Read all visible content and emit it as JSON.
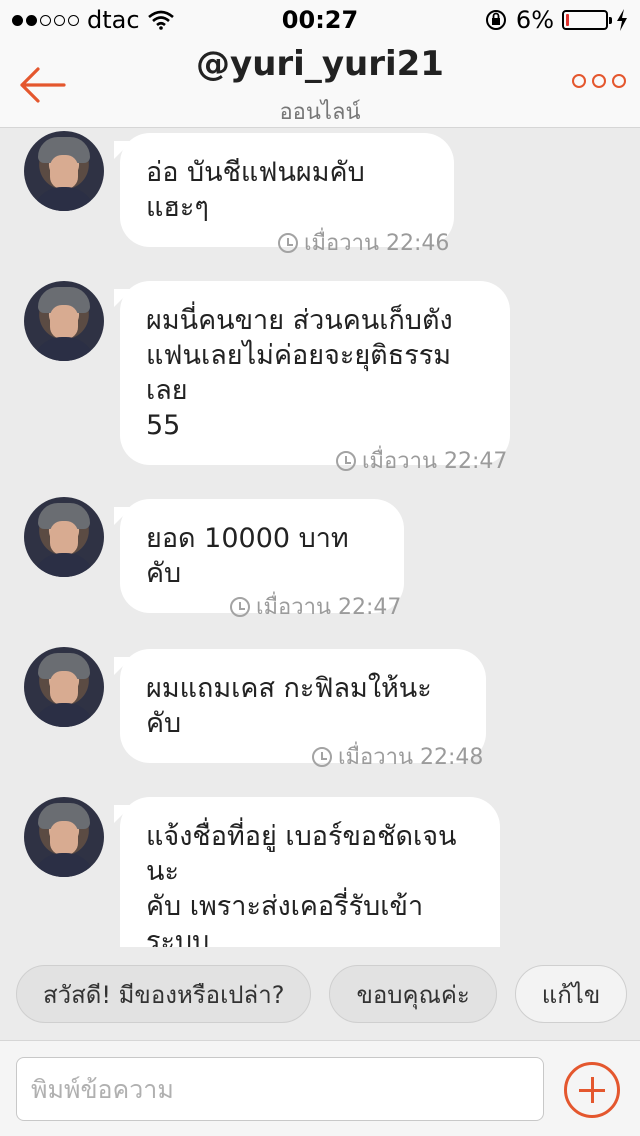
{
  "status_bar": {
    "carrier": "dtac",
    "signal_bars_filled": 2,
    "signal_bars_total": 5,
    "time": "00:27",
    "battery_percent": "6%",
    "battery_level": 0.06
  },
  "header": {
    "title": "@yuri_yuri21",
    "subtitle": "ออนไลน์"
  },
  "messages": [
    {
      "text": "อ่อ บันชีแฟนผมคับ แฮะๆ",
      "time": "เมื่อวาน 22:46"
    },
    {
      "text": "ผมนี่คนขาย ส่วนคนเก็บตัง\nแฟนเลยไม่ค่อยจะยุติธรรมเลย\n55",
      "time": "เมื่อวาน 22:47"
    },
    {
      "text": "ยอด 10000 บาทคับ",
      "time": "เมื่อวาน 22:47"
    },
    {
      "text": "ผมแถมเคส กะฟิลมให้นะคับ",
      "time": "เมื่อวาน 22:48"
    },
    {
      "text": "แจ้งชื่อที่อยู่ เบอร์ขอชัดเจนนะ\nคับ เพราะส่งเคอรี่รับเข้าระบบ\nจะมีข้อความแจ้งไปที่เบอของ\nลูกค้าคับ",
      "time": ""
    }
  ],
  "quick_replies": [
    "สวัสดี! มีของหรือเปล่า?",
    "ขอบคุณค่ะ",
    "แก้ไข"
  ],
  "composer": {
    "placeholder": "พิมพ์ข้อความ"
  },
  "colors": {
    "accent": "#e4572e",
    "chat_background": "#ebebeb",
    "bubble": "#ffffff",
    "timestamp": "#9b9b9b",
    "battery_low": "#e0332f"
  }
}
